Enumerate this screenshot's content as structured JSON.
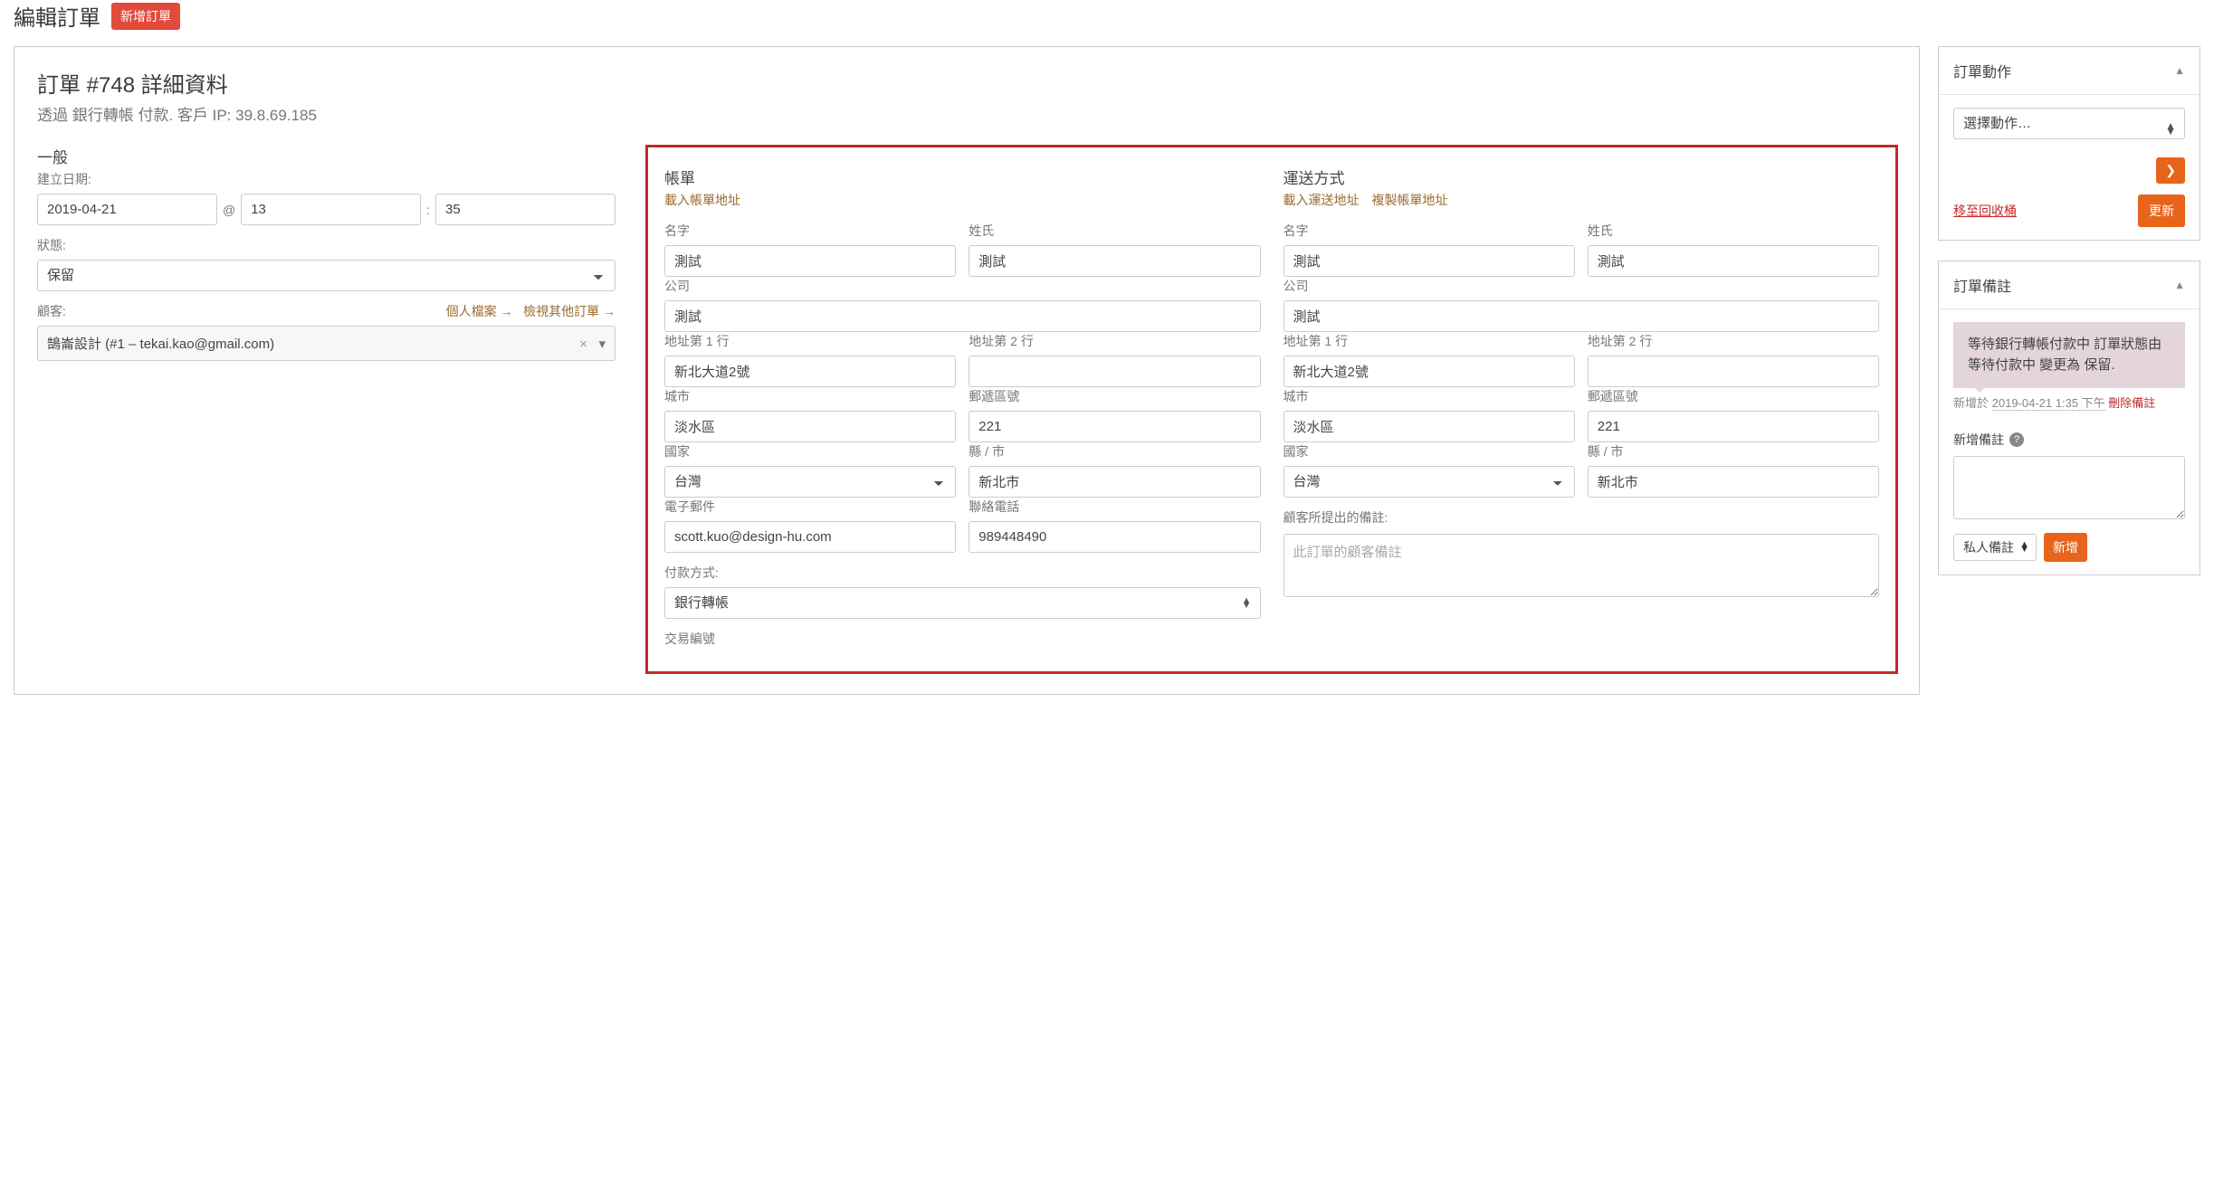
{
  "header": {
    "page_title": "編輯訂單",
    "new_order_btn": "新增訂單"
  },
  "order": {
    "title": "訂單 #748 詳細資料",
    "subtitle": "透過 銀行轉帳 付款. 客戶 IP: 39.8.69.185"
  },
  "general": {
    "section_title": "一般",
    "created_label": "建立日期:",
    "date": "2019-04-21",
    "at": "@",
    "hour": "13",
    "sep": ":",
    "minute": "35",
    "status_label": "狀態:",
    "status": "保留",
    "customer_label": "顧客:",
    "profile_link": "個人檔案 →",
    "other_orders_link": "檢視其他訂單 →",
    "customer": "鵠崙設計 (#1 – tekai.kao@gmail.com)"
  },
  "billing": {
    "section_title": "帳單",
    "load_address_link": "載入帳單地址",
    "first_name_label": "名字",
    "first_name": "測試",
    "last_name_label": "姓氏",
    "last_name": "測試",
    "company_label": "公司",
    "company": "測試",
    "address1_label": "地址第 1 行",
    "address1": "新北大道2號",
    "address2_label": "地址第 2 行",
    "address2": "",
    "city_label": "城市",
    "city": "淡水區",
    "postcode_label": "郵遞區號",
    "postcode": "221",
    "country_label": "國家",
    "country": "台灣",
    "state_label": "縣 / 市",
    "state": "新北市",
    "email_label": "電子郵件",
    "email": "scott.kuo@design-hu.com",
    "phone_label": "聯絡電話",
    "phone": "989448490",
    "payment_method_label": "付款方式:",
    "payment_method": "銀行轉帳",
    "transaction_id_label": "交易編號"
  },
  "shipping": {
    "section_title": "運送方式",
    "load_address_link": "載入運送地址",
    "copy_billing_link": "複製帳單地址",
    "first_name_label": "名字",
    "first_name": "測試",
    "last_name_label": "姓氏",
    "last_name": "測試",
    "company_label": "公司",
    "company": "測試",
    "address1_label": "地址第 1 行",
    "address1": "新北大道2號",
    "address2_label": "地址第 2 行",
    "address2": "",
    "city_label": "城市",
    "city": "淡水區",
    "postcode_label": "郵遞區號",
    "postcode": "221",
    "country_label": "國家",
    "country": "台灣",
    "state_label": "縣 / 市",
    "state": "新北市",
    "customer_note_label": "顧客所提出的備註:",
    "customer_note_placeholder": "此訂單的顧客備註"
  },
  "sidebar": {
    "actions": {
      "title": "訂單動作",
      "select_placeholder": "選擇動作…",
      "trash_link": "移至回收桶",
      "update_btn": "更新"
    },
    "notes": {
      "title": "訂單備註",
      "note_text": "等待銀行轉帳付款中 訂單狀態由 等待付款中 變更為 保留.",
      "note_meta_prefix": "新增於",
      "note_meta_time": "2019-04-21 1:35 下午",
      "delete_note": "刪除備註",
      "add_note_label": "新增備註",
      "note_type": "私人備註",
      "add_btn": "新增"
    }
  }
}
